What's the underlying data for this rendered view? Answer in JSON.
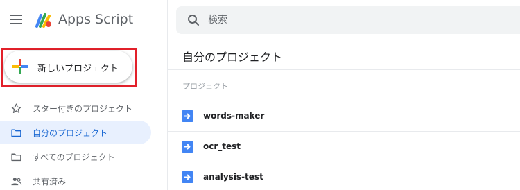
{
  "app": {
    "title": "Apps Script"
  },
  "search": {
    "placeholder": "検索"
  },
  "sidebar": {
    "new_project_label": "新しいプロジェクト",
    "items": [
      {
        "label": "スター付きのプロジェクト",
        "icon": "star-outline-icon"
      },
      {
        "label": "自分のプロジェクト",
        "icon": "folder-icon",
        "active": true
      },
      {
        "label": "すべてのプロジェクト",
        "icon": "folder-icon"
      },
      {
        "label": "共有済み",
        "icon": "people-icon"
      }
    ]
  },
  "main": {
    "title": "自分のプロジェクト",
    "column_header": "プロジェクト",
    "projects": [
      {
        "name": "words-maker",
        "icon": "apps-script-file-icon"
      },
      {
        "name": "ocr_test",
        "icon": "apps-script-file-icon"
      },
      {
        "name": "analysis-test",
        "icon": "apps-script-file-icon"
      }
    ]
  },
  "colors": {
    "accent": "#1967d2",
    "active_bg": "#e8f0fe",
    "highlight_border": "#e2202a",
    "file_icon": "#4285f4"
  }
}
